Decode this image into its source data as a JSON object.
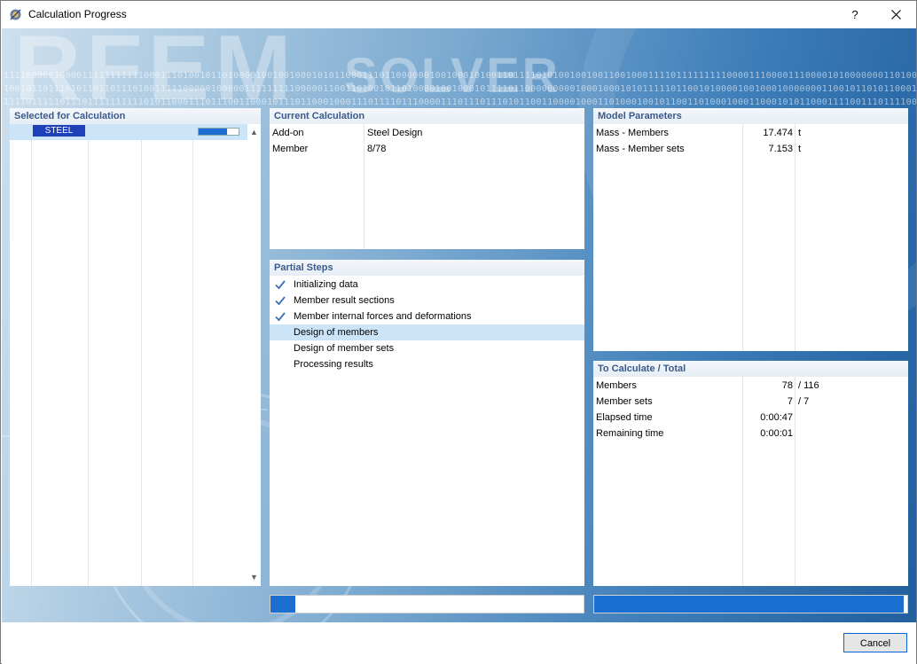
{
  "window": {
    "title": "Calculation Progress",
    "help_label": "?",
    "close_label": "×"
  },
  "background": {
    "brand_text": "RFEM",
    "brand_text_2": "SOLVER",
    "binary_lines": [
      "11110000010000111111111110001110100101101000010010010001010110001110110000001001000101001101111010100100100110010001111011111111100001110000111000010100000001101001100000101",
      "10010110111010110110111010011111000001000001111111110000011001101001011010000100100010111101100000000010001000101011111011001010000100100010000000110010110101100011111101011",
      "11110111110111011111111110101100011101110011000101110110001000111011110111000011101110111010110011000010001101000100101100110100010001100010101100011110011101111001111001001"
    ],
    "accent": "#1b6fd1"
  },
  "selected_for_calculation": {
    "header": "Selected for Calculation",
    "items": [
      {
        "tag": "STEEL",
        "progress_fraction": 0.72
      }
    ]
  },
  "current_calculation": {
    "header": "Current Calculation",
    "rows": [
      {
        "label": "Add-on",
        "value": "Steel Design"
      },
      {
        "label": "Member",
        "value": "8/78"
      }
    ]
  },
  "model_parameters": {
    "header": "Model Parameters",
    "rows": [
      {
        "label": "Mass - Members",
        "value": "17.474",
        "unit": "t"
      },
      {
        "label": "Mass - Member sets",
        "value": "7.153",
        "unit": "t"
      }
    ]
  },
  "partial_steps": {
    "header": "Partial Steps",
    "steps": [
      {
        "label": "Initializing data",
        "done": true
      },
      {
        "label": "Member result sections",
        "done": true
      },
      {
        "label": "Member internal forces and deformations",
        "done": true
      },
      {
        "label": "Design of members",
        "done": false,
        "current": true
      },
      {
        "label": "Design of member sets",
        "done": false
      },
      {
        "label": "Processing results",
        "done": false
      }
    ],
    "progress_fraction": 0.08
  },
  "to_calculate_total": {
    "header": "To Calculate / Total",
    "rows": [
      {
        "label": "Members",
        "value": "78",
        "total": "/ 116"
      },
      {
        "label": "Member sets",
        "value": "7",
        "total": "/ 7"
      },
      {
        "label": "Elapsed time",
        "value": "0:00:47",
        "total": ""
      },
      {
        "label": "Remaining time",
        "value": "0:00:01",
        "total": ""
      }
    ],
    "progress_fraction": 0.99
  },
  "footer": {
    "cancel_label": "Cancel"
  }
}
